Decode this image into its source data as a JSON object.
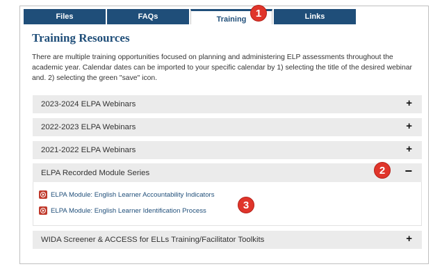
{
  "tabs": [
    {
      "label": "Files"
    },
    {
      "label": "FAQs"
    },
    {
      "label": "Training"
    },
    {
      "label": "Links"
    }
  ],
  "title": "Training Resources",
  "intro": "There are multiple training opportunities focused on planning and administering ELP assessments throughout the academic year. Calendar dates can be imported to your specific calendar by 1) selecting the title of the desired webinar and. 2) selecting the green \"save\" icon.",
  "panels": [
    {
      "label": "2023-2024 ELPA Webinars",
      "toggle": "+"
    },
    {
      "label": "2022-2023 ELPA Webinars",
      "toggle": "+"
    },
    {
      "label": "2021-2022 ELPA Webinars",
      "toggle": "+"
    },
    {
      "label": "ELPA Recorded Module Series",
      "toggle": "−"
    },
    {
      "label": "WIDA Screener & ACCESS for ELLs Training/Facilitator Toolkits",
      "toggle": "+"
    }
  ],
  "modules": [
    {
      "label": "ELPA Module: English Learner Accountability Indicators"
    },
    {
      "label": "ELPA Module: English Learner Identification Process"
    }
  ],
  "badges": [
    "1",
    "2",
    "3"
  ],
  "colors": {
    "brand": "#1f4e79",
    "badge": "#e0352b",
    "play": "#c0392b"
  }
}
